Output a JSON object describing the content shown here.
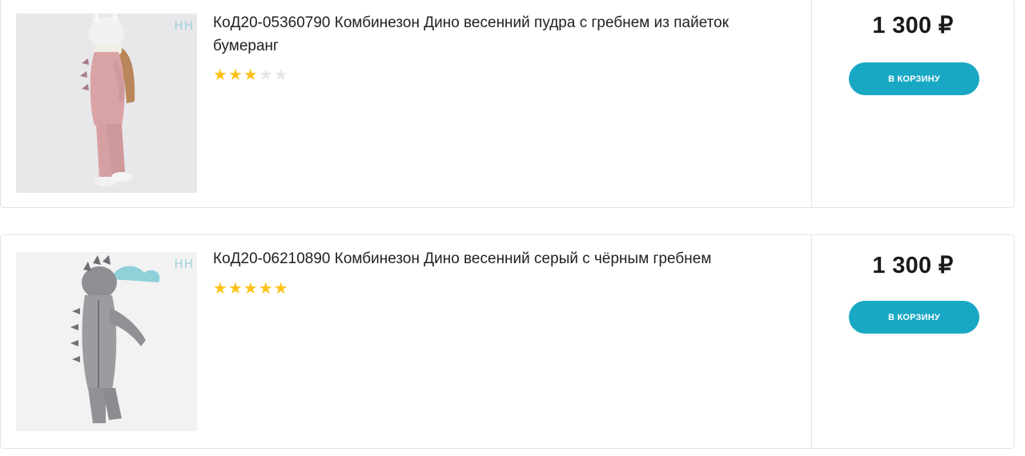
{
  "products": [
    {
      "title": "КоД20-05360790 Комбинезон Дино весенний пудра с гребнем из пайеток бумеранг",
      "rating": 3,
      "rating_max": 5,
      "price": "1 300 ₽",
      "cart_label": "В КОРЗИНУ",
      "brand_mark": "НН"
    },
    {
      "title": "КоД20-06210890 Комбинезон Дино весенний серый с чёрным гребнем",
      "rating": 5,
      "rating_max": 5,
      "price": "1 300 ₽",
      "cart_label": "В КОРЗИНУ",
      "brand_mark": "НН"
    }
  ],
  "colors": {
    "accent": "#18a8c4",
    "star_on": "#ffc21a",
    "star_off": "#e6e6e6",
    "border": "#e4e4e4"
  }
}
